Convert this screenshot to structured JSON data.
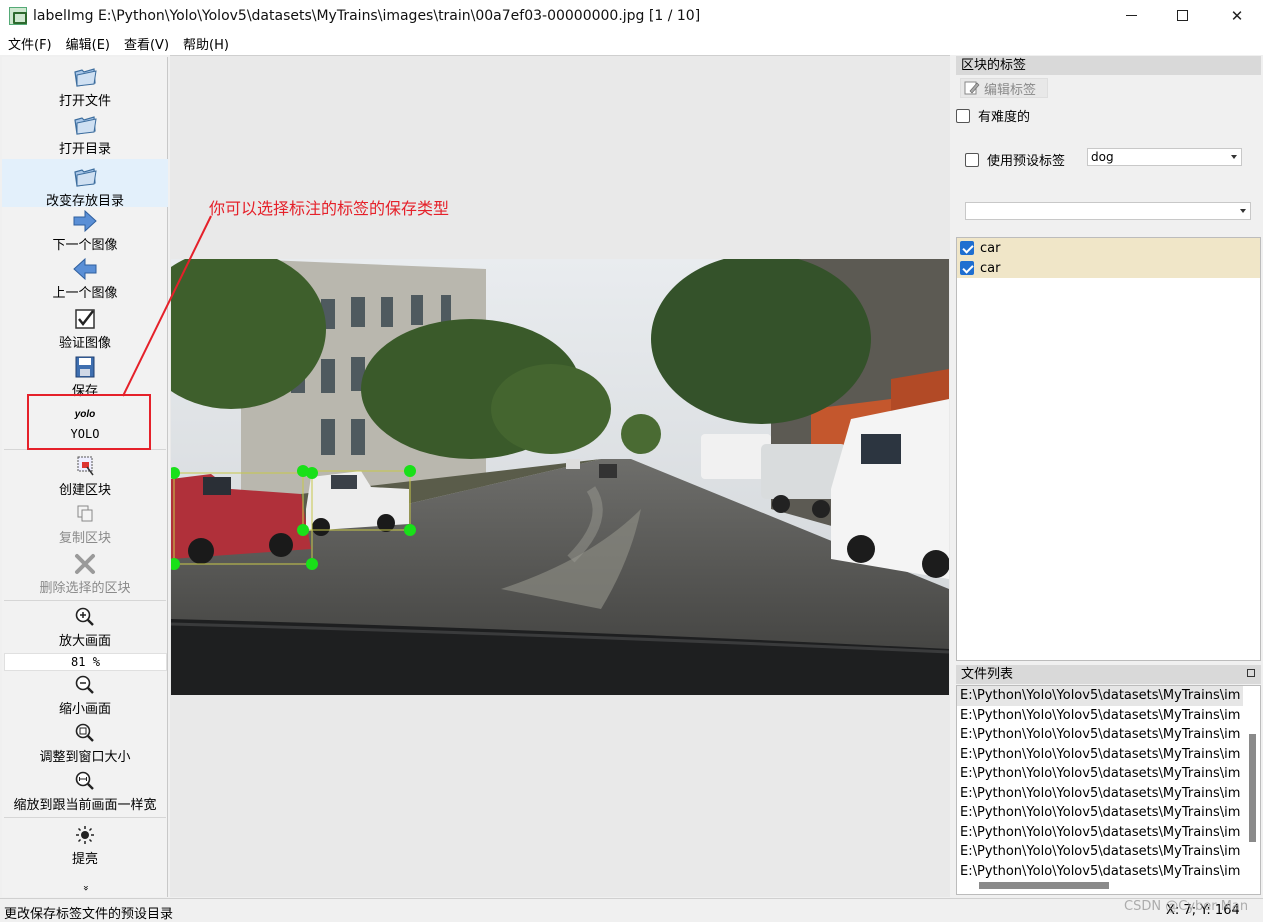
{
  "window": {
    "title": "labelImg E:\\Python\\Yolo\\Yolov5\\datasets\\MyTrains\\images\\train\\00a7ef03-00000000.jpg [1 / 10]",
    "min_glyph": "—",
    "max_glyph": "☐",
    "close_glyph": "✕"
  },
  "menu": [
    "文件(F)",
    "编辑(E)",
    "查看(V)",
    "帮助(H)"
  ],
  "toolbar": {
    "open_file": "打开文件",
    "open_dir": "打开目录",
    "change_save_dir": "改变存放目录",
    "next_image": "下一个图像",
    "prev_image": "上一个图像",
    "verify_image": "验证图像",
    "save": "保存",
    "format_icon_text": "yolo",
    "format": "YOLO",
    "create_box": "创建区块",
    "duplicate_box": "复制区块",
    "delete_box": "删除选择的区块",
    "zoom_in": "放大画面",
    "zoom_value": "81 %",
    "zoom_out": "缩小画面",
    "fit_window": "调整到窗口大小",
    "fit_width": "缩放到跟当前画面一样宽",
    "brightness": "提亮",
    "more": "»"
  },
  "annotation": {
    "text": "你可以选择标注的标签的保存类型",
    "color": "#e5212a"
  },
  "box_labels_panel": {
    "title": "区块的标签",
    "edit_label": "编辑标签",
    "difficult": "有难度的",
    "use_default_label": "使用预设标签",
    "default_label_value": "dog",
    "labels": [
      {
        "name": "car",
        "checked": true
      },
      {
        "name": "car",
        "checked": true
      }
    ]
  },
  "file_list_panel": {
    "title": "文件列表",
    "files": [
      "E:\\Python\\Yolo\\Yolov5\\datasets\\MyTrains\\im",
      "E:\\Python\\Yolo\\Yolov5\\datasets\\MyTrains\\im",
      "E:\\Python\\Yolo\\Yolov5\\datasets\\MyTrains\\im",
      "E:\\Python\\Yolo\\Yolov5\\datasets\\MyTrains\\im",
      "E:\\Python\\Yolo\\Yolov5\\datasets\\MyTrains\\im",
      "E:\\Python\\Yolo\\Yolov5\\datasets\\MyTrains\\im",
      "E:\\Python\\Yolo\\Yolov5\\datasets\\MyTrains\\im",
      "E:\\Python\\Yolo\\Yolov5\\datasets\\MyTrains\\im",
      "E:\\Python\\Yolo\\Yolov5\\datasets\\MyTrains\\im",
      "E:\\Python\\Yolo\\Yolov5\\datasets\\MyTrains\\im"
    ]
  },
  "status": {
    "message": "更改保存标签文件的预设目录",
    "coords": "X: 7; Y: 164",
    "watermark": "CSDN @Cyber Man"
  },
  "colors": {
    "vertex": "#19e019",
    "box_line": "#c8c84a",
    "active_tool": "#e3f0fb"
  }
}
